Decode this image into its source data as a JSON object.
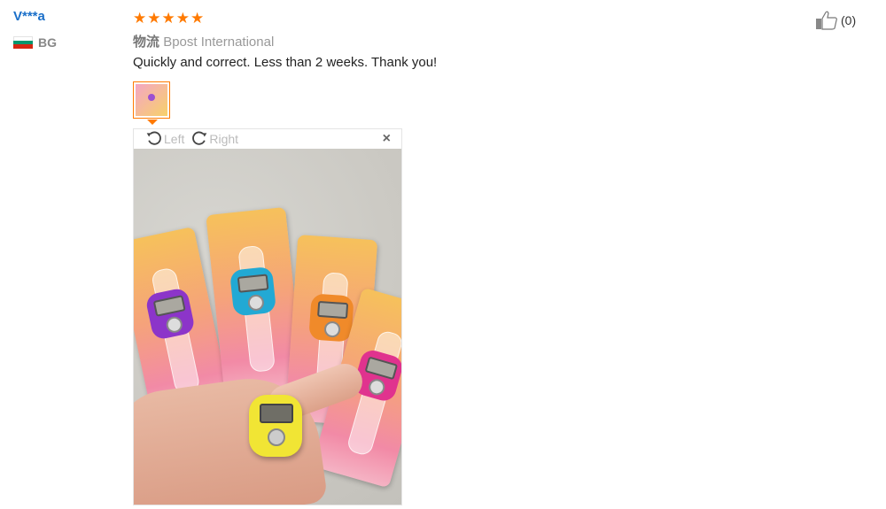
{
  "reviewer": {
    "name": "V***a",
    "country": "BG"
  },
  "rating": {
    "stars": 5
  },
  "logistics": {
    "label": "物流",
    "carrier": "Bpost International"
  },
  "review": {
    "text": "Quickly and correct. Less than 2 weeks. Thank you!"
  },
  "viewer": {
    "rotate_left": "Left",
    "rotate_right": "Right",
    "close": "×"
  },
  "likes": {
    "count": "(0)"
  },
  "colors": {
    "accent": "#ff7a00",
    "username": "#1a6fc9"
  }
}
